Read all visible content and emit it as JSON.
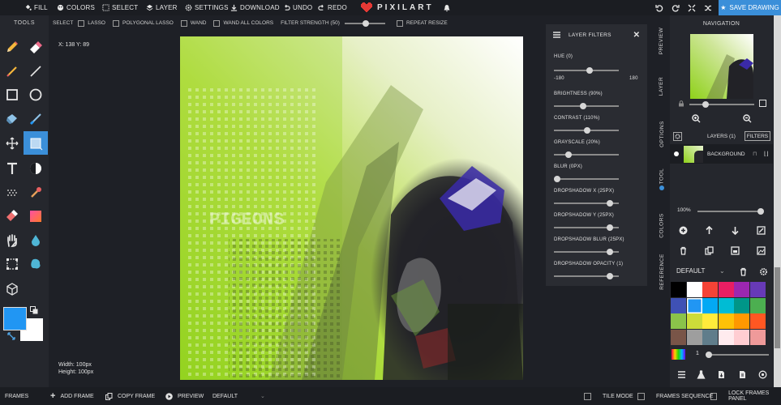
{
  "topbar": {
    "menu": [
      "FILL",
      "COLORS",
      "SELECT",
      "LAYER",
      "SETTINGS",
      "DOWNLOAD",
      "UNDO",
      "REDO"
    ],
    "logo": "PIXILART",
    "save_label": "SAVE DRAWING"
  },
  "selectbar": {
    "label": "SELECT",
    "options": [
      "LASSO",
      "POLYGONAL LASSO",
      "WAND",
      "WAND ALL COLORS"
    ],
    "strength_label": "FILTER STRENGTH (50)",
    "repeat_resize": "REPEAT RESIZE"
  },
  "tools": {
    "title": "TOOLS"
  },
  "colors": {
    "primary": "#2196f3",
    "secondary": "#ffffff",
    "accent": "#3b8fd9"
  },
  "canvas": {
    "coords": "X: 138 Y: 89",
    "width_text": "Width: 100px",
    "height_text": "Height: 100px",
    "watermark": "PIGEONS"
  },
  "filters": {
    "title": "LAYER FILTERS",
    "hue_label": "HUE (0)",
    "hue_min": "-180",
    "hue_max": "180",
    "items": [
      {
        "label": "BRIGHTNESS (90%)",
        "value": 0.45
      },
      {
        "label": "CONTRAST (110%)",
        "value": 0.52
      },
      {
        "label": "GRAYSCALE (20%)",
        "value": 0.2
      },
      {
        "label": "BLUR (0PX)",
        "value": 0.0
      },
      {
        "label": "DROPSHADOW X (25PX)",
        "value": 0.9
      },
      {
        "label": "DROPSHADOW Y (25PX)",
        "value": 0.9
      },
      {
        "label": "DROPSHADOW BLUR (25PX)",
        "value": 0.9
      },
      {
        "label": "DROPSHADOW OPACITY (1)",
        "value": 0.9
      }
    ],
    "hue_value": 0.5
  },
  "sidetabs": [
    "PREVIEW",
    "LAYER",
    "OPTIONS",
    "TOOL",
    "COLORS",
    "REFERENCE"
  ],
  "navigation": {
    "title": "NAVIGATION"
  },
  "layers": {
    "title": "LAYERS (1)",
    "filters_btn": "FILTERS",
    "layer_name": "BACKGROUND",
    "opacity": "100%"
  },
  "palette": {
    "name": "DEFAULT",
    "swatches": [
      "#000000",
      "#ffffff",
      "#f44336",
      "#e91e63",
      "#9c27b0",
      "#673ab7",
      "#3f51b5",
      "#2196f3",
      "#03a9f4",
      "#00bcd4",
      "#009688",
      "#4caf50",
      "#8bc34a",
      "#cddc39",
      "#ffeb3b",
      "#ffc107",
      "#ff9800",
      "#ff5722",
      "#795548",
      "#9e9e9e",
      "#607d8b",
      "#ffebee",
      "#ffcdd2",
      "#ef9a9a"
    ],
    "brush_size": "1"
  },
  "bottombar": {
    "frames": "FRAMES",
    "add_frame": "ADD FRAME",
    "copy_frame": "COPY FRAME",
    "preview": "PREVIEW",
    "default": "DEFAULT",
    "tile_mode": "TILE MODE",
    "frames_sequence": "FRAMES SEQUENCE",
    "lock_frames": "LOCK FRAMES PANEL"
  }
}
